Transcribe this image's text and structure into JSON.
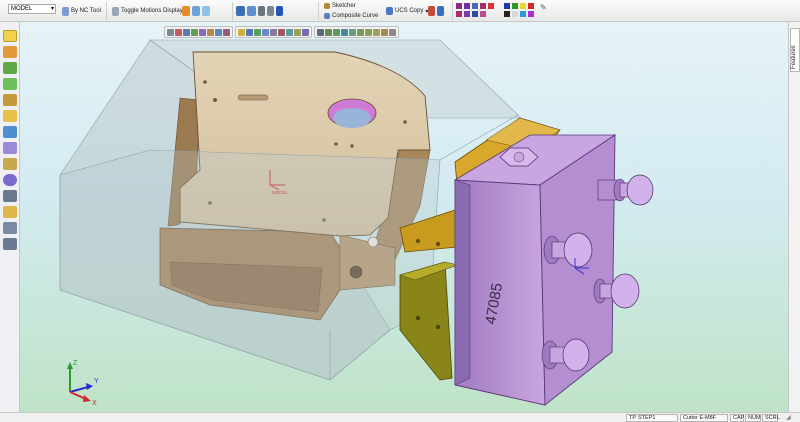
{
  "ribbon": {
    "model_combo": "MODEL",
    "by_nc_tool": "By NC Tool",
    "toggle_motions": "Toggle Motions Display",
    "sketcher": "Sketcher",
    "composite_curve": "Composite Curve",
    "ucs_copy": "UCS Copy"
  },
  "rightbar": {
    "features_tab": "Features"
  },
  "model": {
    "part_number": "47085",
    "ucs_label": "MODEL"
  },
  "triad": {
    "x": "X",
    "y": "Y",
    "z": "Z"
  },
  "status": {
    "tp": "TP",
    "step": "STEP1",
    "cutter_label": "Cutter",
    "cutter_value": "E-M8F",
    "cap": "CAP",
    "num": "NUM",
    "scrl": "SCRL"
  },
  "colors": {
    "accent": "#7a55b0",
    "part": "#d9c7a8",
    "clamp": "#b58ad0",
    "jaw": "#c89a1e",
    "stock": "#b9c7cc"
  }
}
